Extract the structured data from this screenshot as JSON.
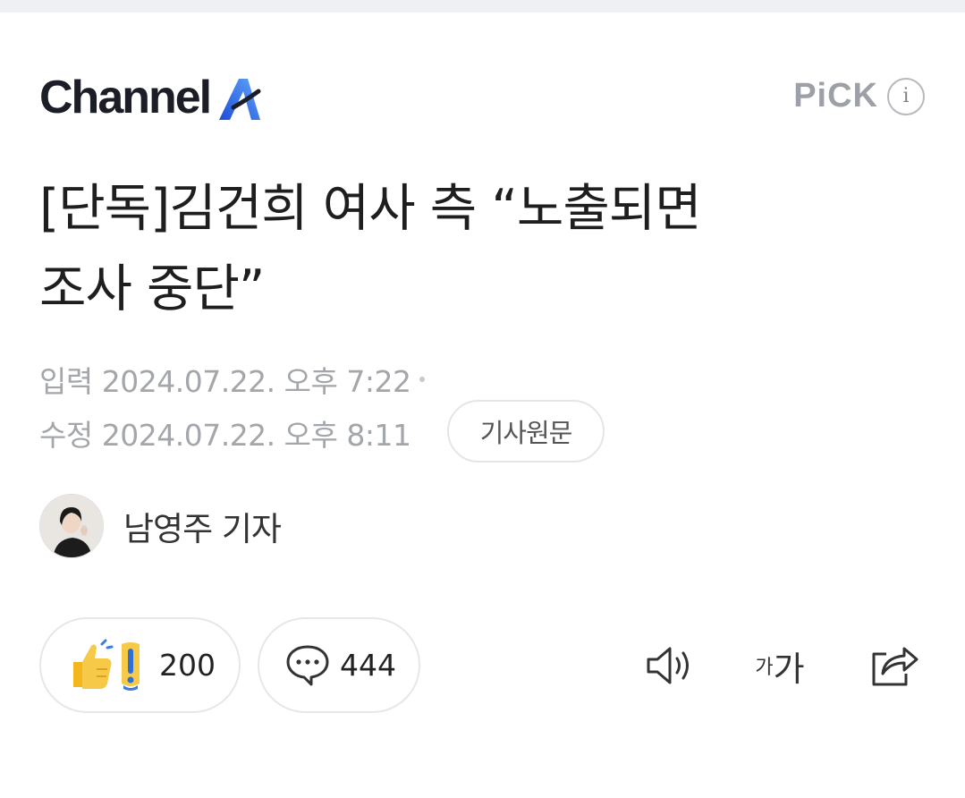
{
  "brand": {
    "name": "Channel",
    "mark": "A",
    "pick_label": "PiCK",
    "info_glyph": "i"
  },
  "article": {
    "title_line1": "[단독]김건희 여사 측 “노출되면",
    "title_line2": "조사 중단”",
    "input_label": "입력",
    "input_datetime": "2024.07.22. 오후 7:22",
    "edit_label": "수정",
    "edit_datetime": "2024.07.22. 오후 8:11",
    "source_button": "기사원문",
    "reporter": "남영주 기자"
  },
  "actions": {
    "reaction_count": "200",
    "comment_count": "444",
    "font_small": "가",
    "font_big": "가"
  },
  "icons": {
    "info": "info-icon",
    "reaction": "thumbs-up-exclamation-icon",
    "comment": "speech-bubble-icon",
    "speak": "speaker-icon",
    "font": "font-size-icon",
    "share": "share-icon"
  },
  "colors": {
    "logo_dark": "#1b1e27",
    "logo_accent": "#3b82f6",
    "meta_gray": "#a3a6aa",
    "reaction_yellow": "#f7c948",
    "reaction_blue": "#3b7de0"
  }
}
